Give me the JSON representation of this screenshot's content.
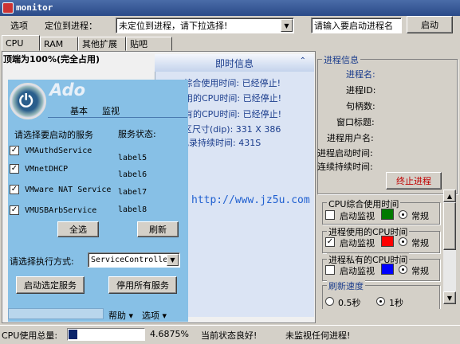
{
  "window": {
    "title": "monitor"
  },
  "toolbar": {
    "options_label": "选项",
    "locate_label": "定位到进程：",
    "locate_value": "未定位到进程，请下拉选择!",
    "start_input_placeholder": "请输入要启动进程名",
    "start_button": "启动"
  },
  "tabs": [
    "CPU",
    "RAM",
    "其他扩展",
    "贴吧"
  ],
  "main": {
    "header": "顶端为100%(完全占用)",
    "info_title": "即时信息",
    "info_lines": [
      "CPU综合使用时间: 已经停止!",
      "进程使用的CPU时间: 已经停止!",
      "进程私有的CPU时间: 已经停止!",
      "绘图区尺寸(dip): 331  X  386",
      "记录持续时间:  431S"
    ],
    "url": "http://www.jz5u.com"
  },
  "float_panel": {
    "logo_letters": "Ado",
    "tab_basic": "基本",
    "tab_monitor": "监视",
    "select_service_label": "请选择要启动的服务",
    "service_status_label": "服务状态:",
    "services": [
      {
        "name": "VMAuthdService",
        "status": "label5",
        "checked": true
      },
      {
        "name": "VMnetDHCP",
        "status": "label6",
        "checked": true
      },
      {
        "name": "VMware NAT Service",
        "status": "label7",
        "checked": true
      },
      {
        "name": "VMUSBArbService",
        "status": "label8",
        "checked": true
      }
    ],
    "select_all": "全选",
    "refresh": "刷新",
    "exec_mode_label": "请选择执行方式:",
    "exec_mode_value": "ServiceControlle",
    "start_selected": "启动选定服务",
    "stop_all": "停用所有服务",
    "help": "帮助",
    "options": "选项"
  },
  "process_info": {
    "title": "进程信息",
    "fields": [
      "进程名:",
      "进程ID:",
      "句柄数:",
      "窗口标题:",
      "进程用户名:",
      "进程启动时间:",
      "连续持续时间:"
    ],
    "terminate": "终止进程"
  },
  "monitor_groups": [
    {
      "title": "CPU综合使用时间",
      "enabled": false,
      "color": "#007a00",
      "mode": "常规"
    },
    {
      "title": "进程使用的CPU时间",
      "enabled": true,
      "color": "#ff0000",
      "mode": "常规"
    },
    {
      "title": "进程私有的CPU时间",
      "enabled": false,
      "color": "#0000ff",
      "mode": "常规"
    }
  ],
  "monitor_common": {
    "start_monitor": "启动监视"
  },
  "refresh_speed": {
    "title": "刷新速度",
    "options": [
      "0.5秒",
      "1秒"
    ],
    "selected": "1秒"
  },
  "status_bar": {
    "cpu_label": "CPU使用总量:",
    "cpu_usage_percent": 4.6875,
    "cpu_value": "4.6875%",
    "state": "当前状态良好!",
    "watching": "未监视任何进程!"
  }
}
